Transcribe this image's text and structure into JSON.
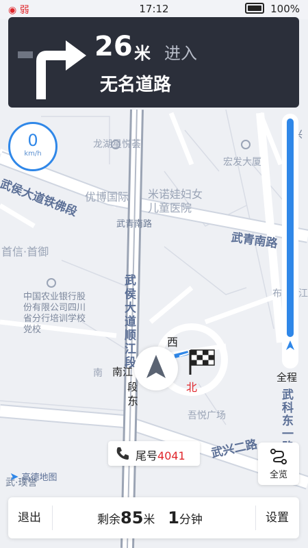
{
  "status_bar": {
    "signal": "弱",
    "time": "17:12",
    "battery": "100%"
  },
  "instruction": {
    "distance": "26",
    "unit": "米",
    "action": "进入",
    "road": "无名道路",
    "icon": "turn-right-arrow-icon"
  },
  "speed": {
    "value": "0",
    "unit": "km/h"
  },
  "route_progress": {
    "label": "全程",
    "fraction_remaining": 0.89
  },
  "map_labels": {
    "wuhou_tiefo": "武侯大道铁佛段",
    "wuqing_south_road": "武青南路",
    "wuqing_south_road_small": "武青南路",
    "wuhou_shunjiang": "武侯大道顺江段",
    "wuxing_2nd_road": "武兴二路",
    "wuke_east": "武科东一路",
    "wuxing_top": "武兴",
    "longhu": "龙湖星悦荟",
    "hongfa": "宏发大厦",
    "youbo": "优博国际",
    "minuowa": "米诺娃妇女儿童医院",
    "shouxin": "首信·首御",
    "agri_bank": "中国农业银行股份有限公司四川省分行培训学校党校",
    "yinyue": "吾悦广场",
    "wuyu": "武·璞誉",
    "nanjiang": "南江",
    "duan": "段",
    "xi": "西",
    "dong": "东",
    "bei": "北",
    "nan": "南",
    "bu": "布",
    "jiang": "江"
  },
  "plate": {
    "prefix": "尾号",
    "number": "4041"
  },
  "overview_button": {
    "label": "全览"
  },
  "logo": {
    "text": "高德地图"
  },
  "bottom_bar": {
    "exit_label": "退出",
    "remaining_prefix": "剩余",
    "remaining_distance": "85",
    "distance_unit": "米",
    "remaining_time": "1",
    "time_unit": "分钟",
    "settings_label": "设置"
  },
  "colors": {
    "accent": "#2f87e8",
    "nav_bg": "#2b2f3a",
    "red": "#e0262b"
  }
}
